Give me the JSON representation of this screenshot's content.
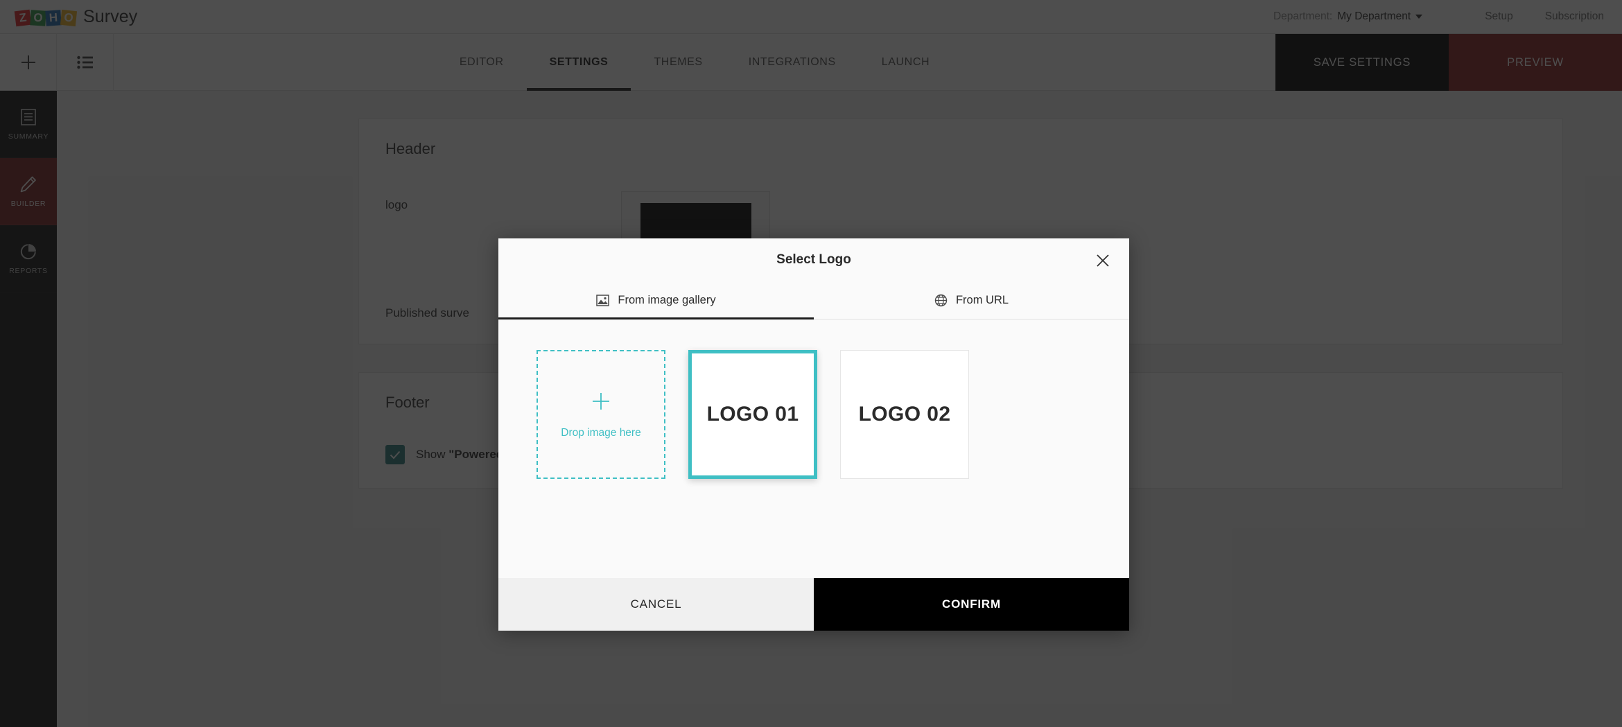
{
  "app": {
    "brand_letters": [
      "Z",
      "O",
      "H",
      "O"
    ],
    "brand_name": "Survey",
    "brand_colors": {
      "z": "#e42527",
      "o1": "#2a9c49",
      "h": "#1d6fb7",
      "o2": "#f0b223"
    }
  },
  "topbar": {
    "department_label": "Department:",
    "department_value": "My Department",
    "setup_link": "Setup",
    "subscription_link": "Subscription"
  },
  "tabbar": {
    "add_icon": "plus-icon",
    "list_icon": "list-icon",
    "tabs": [
      {
        "label": "EDITOR",
        "active": false
      },
      {
        "label": "SETTINGS",
        "active": true
      },
      {
        "label": "THEMES",
        "active": false
      },
      {
        "label": "INTEGRATIONS",
        "active": false
      },
      {
        "label": "LAUNCH",
        "active": false
      }
    ],
    "save_label": "SAVE SETTINGS",
    "preview_label": "PREVIEW",
    "save_bg": "#000000",
    "preview_bg": "#8c1d1d"
  },
  "sidebar": {
    "items": [
      {
        "label": "SUMMARY",
        "icon": "document-icon",
        "active": false
      },
      {
        "label": "BUILDER",
        "icon": "pencil-icon",
        "active": true
      },
      {
        "label": "REPORTS",
        "icon": "pie-chart-icon",
        "active": false
      }
    ],
    "active_bg": "#7a1f1f"
  },
  "content": {
    "header_card": {
      "title": "Header",
      "logo_label": "logo",
      "published_label": "Published surve"
    },
    "footer_card": {
      "title": "Footer",
      "checkbox_checked": true,
      "checkbox_color": "#2c7f7d",
      "show_prefix": "Show ",
      "show_quoted": "\"Powered by Zoho Survey\""
    }
  },
  "modal": {
    "title": "Select Logo",
    "close_icon": "close-icon",
    "tabs": [
      {
        "label": "From image gallery",
        "icon": "image-icon",
        "active": true
      },
      {
        "label": "From URL",
        "icon": "globe-icon",
        "active": false
      }
    ],
    "dropzone": {
      "plus_icon": "plus-icon",
      "text": "Drop image here",
      "accent": "#3fbfc4"
    },
    "gallery": [
      {
        "label": "LOGO 01",
        "selected": true
      },
      {
        "label": "LOGO 02",
        "selected": false
      }
    ],
    "cancel_label": "CANCEL",
    "confirm_label": "CONFIRM",
    "accent_color": "#3fbfc4"
  }
}
